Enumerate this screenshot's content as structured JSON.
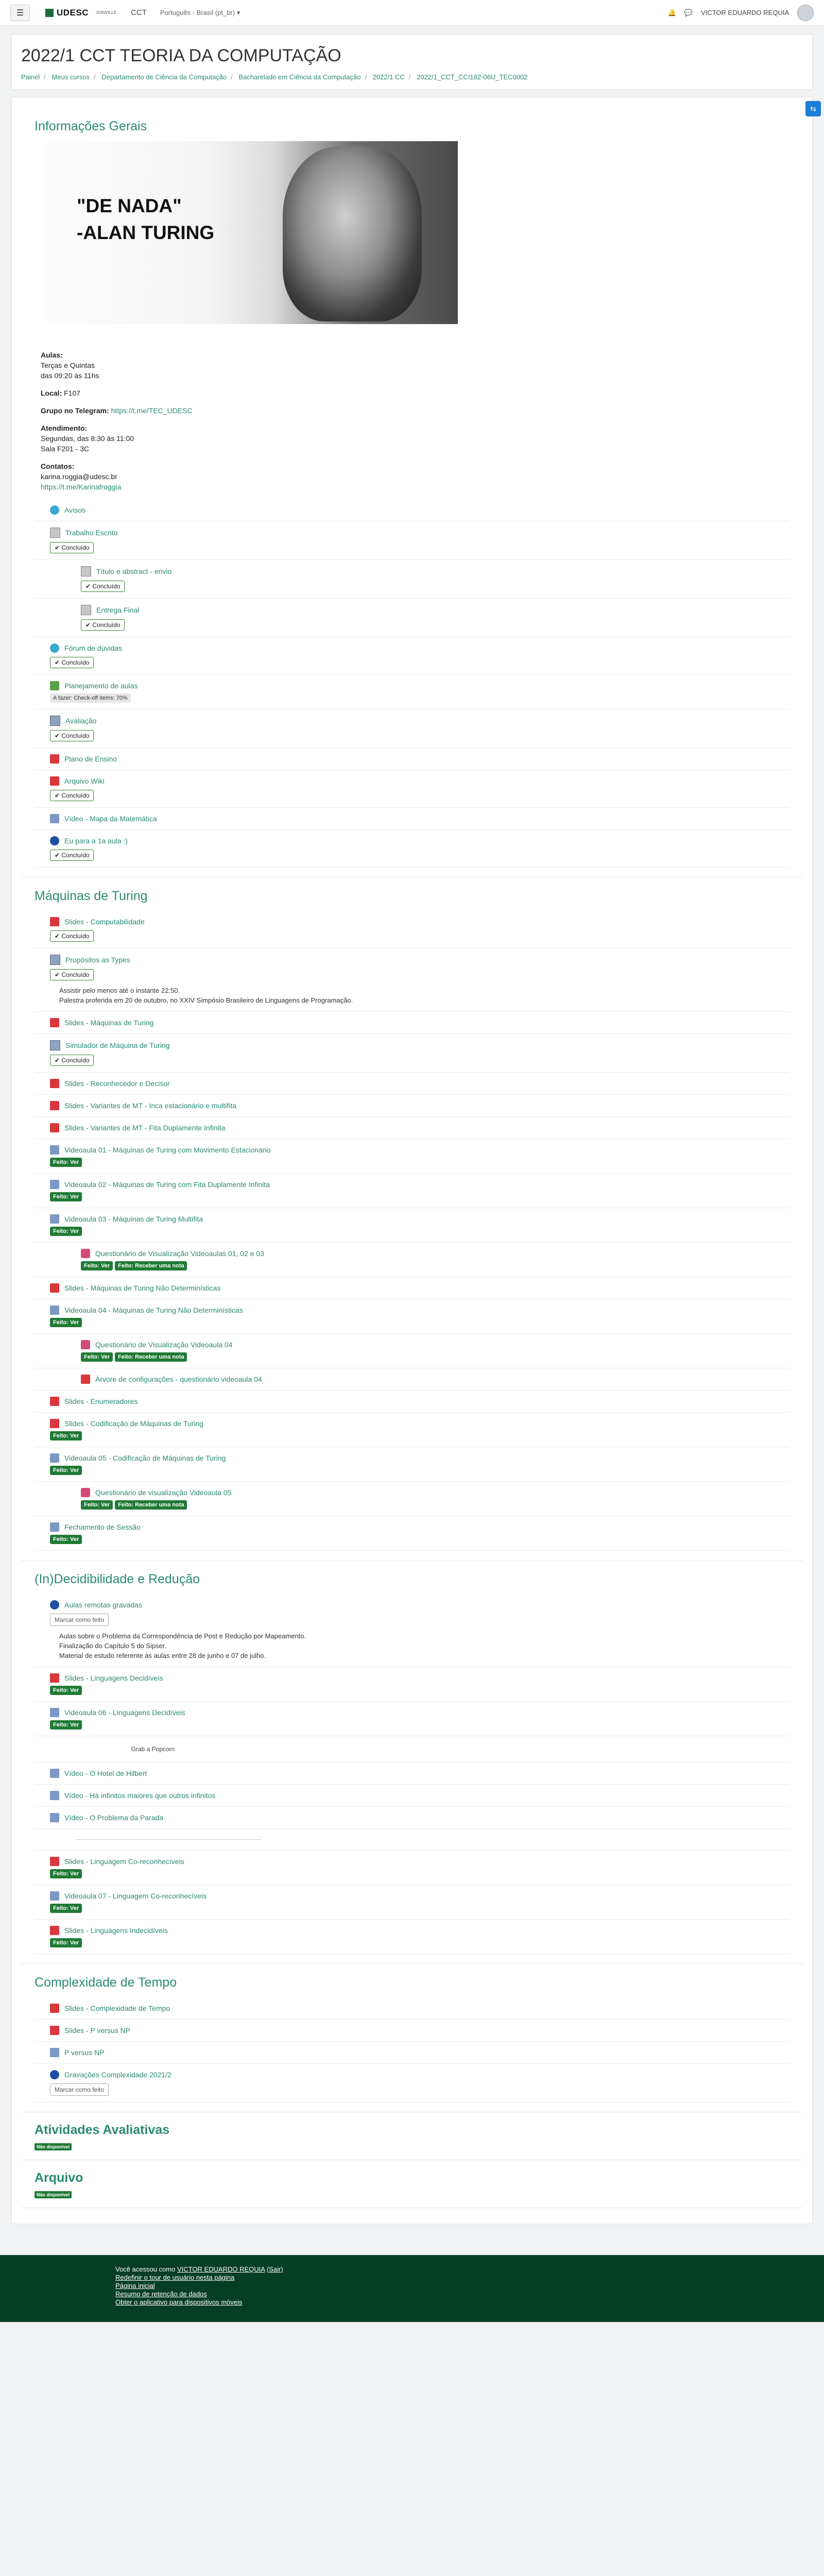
{
  "topbar": {
    "logo_text": "UDESC",
    "logo_small": "JOINVILLE",
    "nav_item": "CCT",
    "language": "Português - Brasil (pt_br) ▾",
    "user_name": "VICTOR EDUARDO REQUIA"
  },
  "header": {
    "title": "2022/1 CCT TEORIA DA COMPUTAÇÃO",
    "breadcrumb": [
      "Painel",
      "Meus cursos",
      "Departamento de Ciência da Computação",
      "Bacharelado em Ciência da Computação",
      "2022/1 CC",
      "2022/1_CCT_CCI182-06U_TEC0002"
    ]
  },
  "section1": {
    "title": "Informações Gerais",
    "banner_line1": "\"DE NADA\"",
    "banner_line2": "-ALAN TURING",
    "aulas_label": "Aulas:",
    "aulas_line1": "Terças e Quintas",
    "aulas_line2": "das 09:20 às 11hs",
    "local_label": "Local:",
    "local_value": "F107",
    "grupo_label": "Grupo no Telegram:",
    "grupo_link": "https://t.me/TEC_UDESC",
    "atend_label": "Atendimento:",
    "atend_line1": "Segundas, das 8:30 às 11:00",
    "atend_line2": "Sala F201 - 3C",
    "contatos_label": "Contatos:",
    "contatos_line1": "karina.roggia@udesc.br",
    "contatos_line2": "https://t.me/Karinafroggia",
    "items": [
      {
        "name": "Avisos"
      },
      {
        "name": "Trabalho Escrito",
        "done": "Concluído"
      },
      {
        "name": "Título e abstract - envio",
        "done": "Concluído"
      },
      {
        "name": "Entrega Final",
        "done": "Concluído"
      },
      {
        "name": "Fórum de dúvidas",
        "done": "Concluído"
      },
      {
        "name": "Planejamento de aulas",
        "todo": "A fazer: Check-off items: 70%"
      },
      {
        "name": "Avaliação",
        "done": "Concluído"
      },
      {
        "name": "Plano de Ensino"
      },
      {
        "name": "Arquivo Wiki",
        "done": "Concluído"
      },
      {
        "name": "Vídeo - Mapa da Matemática"
      },
      {
        "name": "Eu para a 1a aula :)",
        "done": "Concluído"
      }
    ]
  },
  "section2": {
    "title": "Máquinas de Turing",
    "items": [
      {
        "name": "Slides - Computabilidade",
        "done": "Concluído"
      },
      {
        "name": "Propósitos as Types",
        "done": "Concluído"
      },
      {
        "name": "Slides - Máquinas de Turing"
      },
      {
        "name": "Simulador de Máquina de Turing",
        "done": "Concluído"
      },
      {
        "name": "Slides - Reconhecedor e Decisor"
      },
      {
        "name": "Slides - Variantes de MT - Inca estacionário e multifita"
      },
      {
        "name": "Slides - Variantes de MT - Fita Duplamente Infinita"
      },
      {
        "name": "Videoaula 01 - Máquinas de Turing com Movimento Estacionário",
        "badge": "Feito: Ver"
      },
      {
        "name": "Videoaula 02 - Máquinas de Turing com Fita Duplamente Infinita",
        "badge": "Feito: Ver"
      },
      {
        "name": "Videoaula 03 - Máquinas de Turing Multifita",
        "badge": "Feito: Ver"
      },
      {
        "name": "Questionário de Visualização Videoaulas 01, 02 e 03",
        "badge": "Feito: Ver",
        "badge2": "Feito: Receber uma nota"
      },
      {
        "name": "Slides - Máquinas de Turing Não Determinísticas"
      },
      {
        "name": "Videoaula 04 - Máquinas de Turing Não Determinísticas",
        "badge": "Feito: Ver"
      },
      {
        "name": "Questionário de Visualização Videoaula 04",
        "badge": "Feito: Ver",
        "badge2": "Feito: Receber uma nota"
      },
      {
        "name": "Árvore de configurações - questionário videoaula 04"
      },
      {
        "name": "Slides - Enumeradores"
      },
      {
        "name": "Slides - Codificação de Máquinas de Turing",
        "badge": "Feito: Ver"
      },
      {
        "name": "Videoaula 05 - Codificação de Máquinas de Turing",
        "badge": "Feito: Ver"
      },
      {
        "name": "Questionário de visualização Videoaula 05",
        "badge": "Feito: Ver",
        "badge2": "Feito: Receber uma nota"
      },
      {
        "name": "Fechamento de Sessão",
        "badge": "Feito: Ver"
      }
    ],
    "assoc_text1": "Assistir pelo menos até o instante 22:50.",
    "assoc_text2": "Palestra proferida em 20 de outubro, no XXIV Simpósio Brasileiro de Linguagens de Programação."
  },
  "section3": {
    "title": "(In)Decidibilidade e Redução",
    "items": [
      {
        "name": "Aulas remotas gravadas",
        "mark": "Marcar como feito"
      },
      {
        "name": "Slides - Linguagens Decidíveis",
        "badge": "Feito: Ver"
      },
      {
        "name": "Videoaula 06 - Linguagens Decidíveis",
        "badge": "Feito: Ver"
      },
      {
        "name": "Vídeo - O Hotel de Hilbert"
      },
      {
        "name": "Vídeo - Há infinitos maiores que outros infinitos"
      },
      {
        "name": "Vídeo - O Problema da Parada"
      },
      {
        "name": "Slides - Linguagem Co-reconhecíveis",
        "badge": "Feito: Ver"
      },
      {
        "name": "Videoaula 07 - Linguagem Co-reconhecíveis",
        "badge": "Feito: Ver"
      },
      {
        "name": "Slides - Linguagens Indecidíveis",
        "badge": "Feito: Ver"
      }
    ],
    "desc1": "Aulas sobre o Problema da Correspondência de Post e Redução por Mapeamento.",
    "desc2": "Finalização do Capítulo 5 do Sipser.",
    "desc3": "Material de estudo referente às aulas entre 28 de junho e 07 de julho.",
    "divider_label": "Grab a Popcorn"
  },
  "section4": {
    "title": "Complexidade de Tempo",
    "items": [
      {
        "name": "Slides - Complexidade de Tempo"
      },
      {
        "name": "Slides - P versus NP"
      },
      {
        "name": "P versus NP"
      },
      {
        "name": "Gravações Complexidade 2021/2",
        "mark": "Marcar como feito"
      }
    ]
  },
  "section5": {
    "title": "Atividades Avaliativas",
    "badge": "Não disponível"
  },
  "section6": {
    "title": "Arquivo",
    "badge": "Não disponível"
  },
  "footer": {
    "logged_prefix": "Você acessou como",
    "logged_user": "VICTOR EDUARDO REQUIA",
    "logout": "(Sair)",
    "link1": "Redefinir o tour de usuário nesta página",
    "link2": "Página inicial",
    "link3": "Resumo de retenção de dados",
    "link4": "Obter o aplicativo para dispositivos móveis"
  }
}
